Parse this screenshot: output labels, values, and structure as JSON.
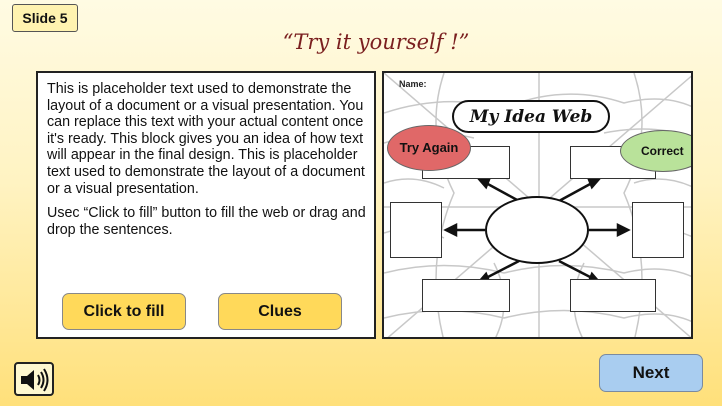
{
  "slide_badge": "Slide 5",
  "title": "“Try it yourself !”",
  "instructions": {
    "paragraph": "This is placeholder text used to demonstrate the layout of a document or a visual presentation. You can replace this text with your actual content once it's ready. This block gives you an idea of how text will appear in the final design. This is placeholder text used to demonstrate the layout of a document or a visual presentation.",
    "usage": "Usec “Click to fill” button to fill the web or drag and drop the sentences."
  },
  "buttons": {
    "click_to_fill": "Click to fill",
    "clues": "Clues",
    "next": "Next"
  },
  "worksheet": {
    "name_label": "Name:",
    "title": "My Idea Web",
    "try_again": "Try Again",
    "correct": "Correct"
  },
  "icons": {
    "speaker": "speaker-icon"
  },
  "colors": {
    "title": "#7a1f1f",
    "button_yellow": "#ffd95a",
    "next_blue": "#a9cdf0",
    "try_again_red": "#e06868",
    "correct_green": "#b9e29a"
  }
}
